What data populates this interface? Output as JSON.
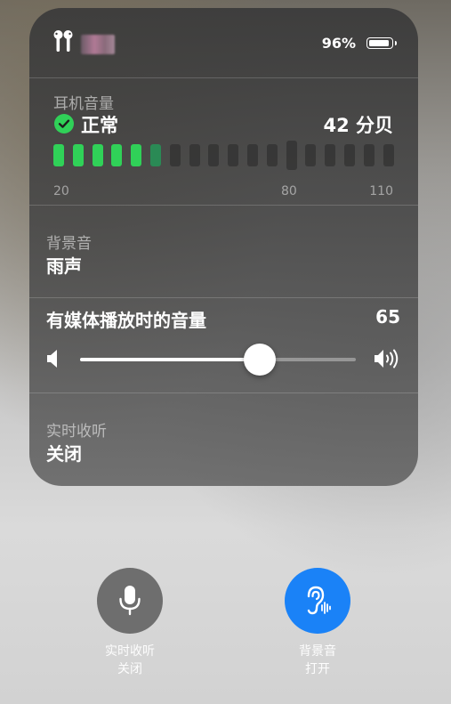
{
  "status_bar": {
    "battery_percent": "96%",
    "battery_level": 0.96
  },
  "headphone_level": {
    "label": "耳机音量",
    "status": "正常",
    "db": "42 分贝",
    "meter": {
      "active_bars": 6,
      "total_bars": 18,
      "marker_index": 12,
      "scale": [
        "20",
        "80",
        "110"
      ]
    }
  },
  "background_sounds": {
    "label": "背景音",
    "value": "雨声"
  },
  "media_volume": {
    "label": "有媒体播放时的音量",
    "value": "65",
    "level": 0.65
  },
  "live_listen": {
    "label": "实时收听",
    "value": "关闭"
  },
  "bottom_controls": [
    {
      "name": "live-listen",
      "title": "实时收听",
      "state": "关闭",
      "color": "#6e6e6e",
      "icon": "microphone-icon"
    },
    {
      "name": "background-sounds",
      "title": "背景音",
      "state": "打开",
      "color": "#1a82f7",
      "icon": "ear-icon"
    }
  ],
  "colors": {
    "meter_active": "#30d158",
    "meter_dim_active": "#2a8a55",
    "meter_inactive": "rgba(40,40,40,0.55)"
  }
}
